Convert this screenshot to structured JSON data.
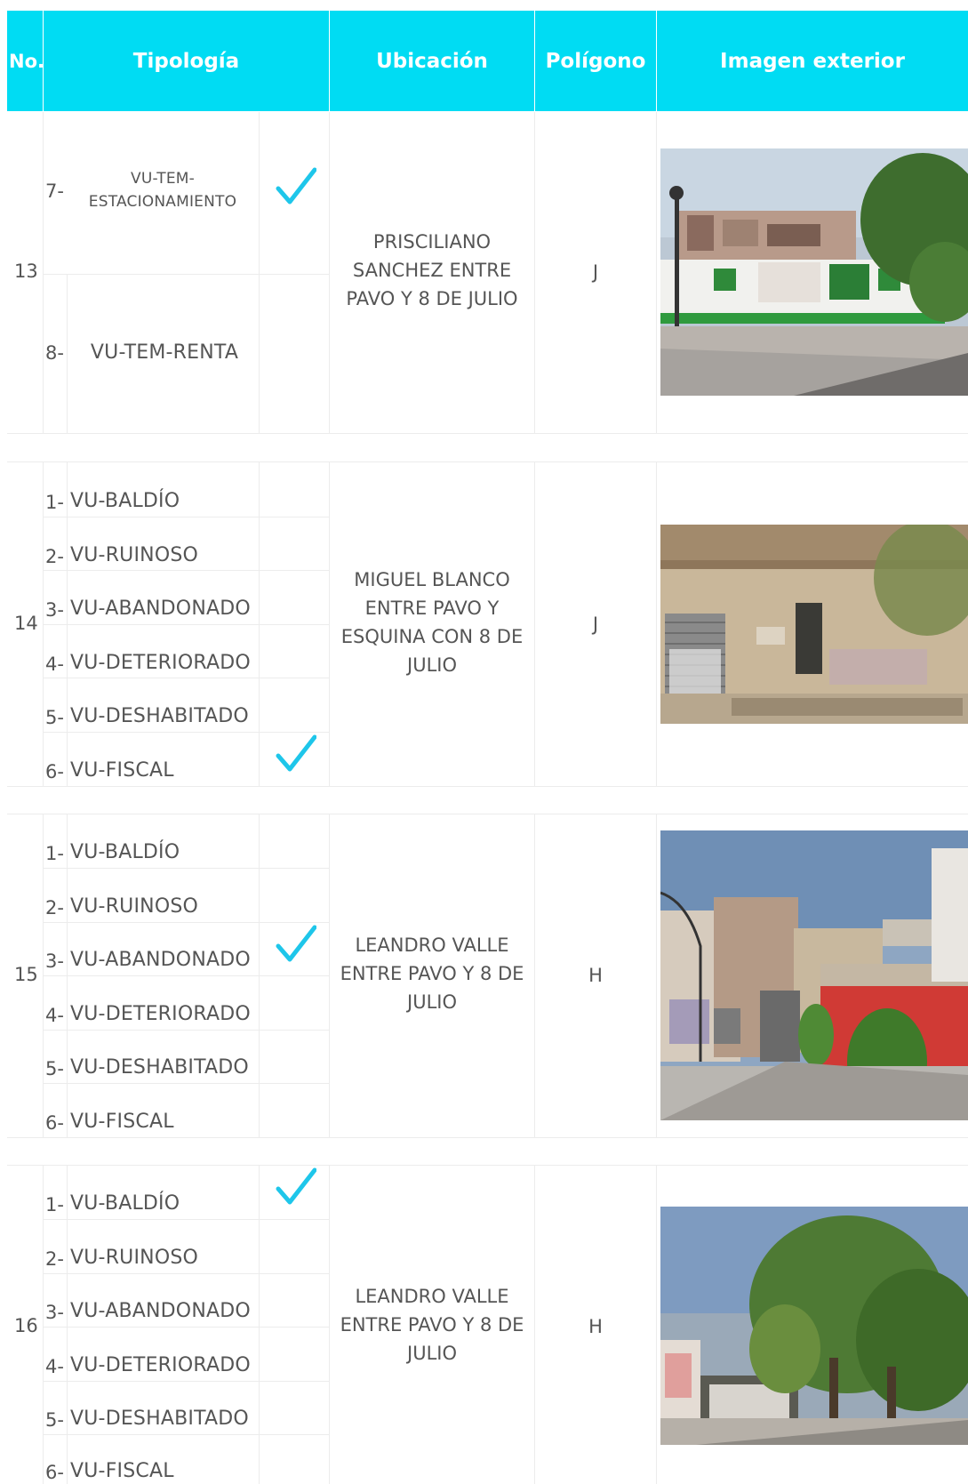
{
  "header": {
    "no": "No.",
    "tipologia": "Tipología",
    "ubicacion": "Ubicación",
    "poligono": "Polígono",
    "imagen": "Imagen exterior"
  },
  "colors": {
    "header_bg": "#00dcf3",
    "check": "#1ec6ea",
    "text": "#555555"
  },
  "rows": [
    {
      "no": "13",
      "tipologia": [
        {
          "num": "7-",
          "label": "VU-TEM-ESTACIONAMIENTO",
          "checked": true
        },
        {
          "num": "8-",
          "label": "VU-TEM-RENTA",
          "checked": false
        }
      ],
      "ubicacion": "PRISCILIANO SANCHEZ ENTRE PAVO Y 8 DE JULIO",
      "poligono": "J",
      "image": "street-photo-parking-lot"
    },
    {
      "no": "14",
      "tipologia": [
        {
          "num": "1-",
          "label": "VU-BALDÍO",
          "checked": false
        },
        {
          "num": "2-",
          "label": "VU-RUINOSO",
          "checked": false
        },
        {
          "num": "3-",
          "label": "VU-ABANDONADO",
          "checked": false
        },
        {
          "num": "4-",
          "label": "VU-DETERIORADO",
          "checked": false
        },
        {
          "num": "5-",
          "label": "VU-DESHABITADO",
          "checked": false
        },
        {
          "num": "6-",
          "label": "VU-FISCAL",
          "checked": true
        }
      ],
      "ubicacion": "MIGUEL BLANCO ENTRE PAVO Y ESQUINA CON  8 DE JULIO",
      "poligono": "J",
      "image": "street-photo-old-facade"
    },
    {
      "no": "15",
      "tipologia": [
        {
          "num": "1-",
          "label": "VU-BALDÍO",
          "checked": false
        },
        {
          "num": "2-",
          "label": "VU-RUINOSO",
          "checked": false
        },
        {
          "num": "3-",
          "label": "VU-ABANDONADO",
          "checked": true
        },
        {
          "num": "4-",
          "label": "VU-DETERIORADO",
          "checked": false
        },
        {
          "num": "5-",
          "label": "VU-DESHABITADO",
          "checked": false
        },
        {
          "num": "6-",
          "label": "VU-FISCAL",
          "checked": false
        }
      ],
      "ubicacion": "LEANDRO VALLE ENTRE PAVO Y 8 DE JULIO",
      "poligono": "H",
      "image": "street-photo-red-building"
    },
    {
      "no": "16",
      "tipologia": [
        {
          "num": "1-",
          "label": "VU-BALDÍO",
          "checked": true
        },
        {
          "num": "2-",
          "label": "VU-RUINOSO",
          "checked": false
        },
        {
          "num": "3-",
          "label": "VU-ABANDONADO",
          "checked": false
        },
        {
          "num": "4-",
          "label": "VU-DETERIORADO",
          "checked": false
        },
        {
          "num": "5-",
          "label": "VU-DESHABITADO",
          "checked": false
        },
        {
          "num": "6-",
          "label": "VU-FISCAL",
          "checked": false
        }
      ],
      "ubicacion": "LEANDRO VALLE ENTRE PAVO Y 8 DE JULIO",
      "poligono": "H",
      "image": "street-photo-trees"
    }
  ]
}
